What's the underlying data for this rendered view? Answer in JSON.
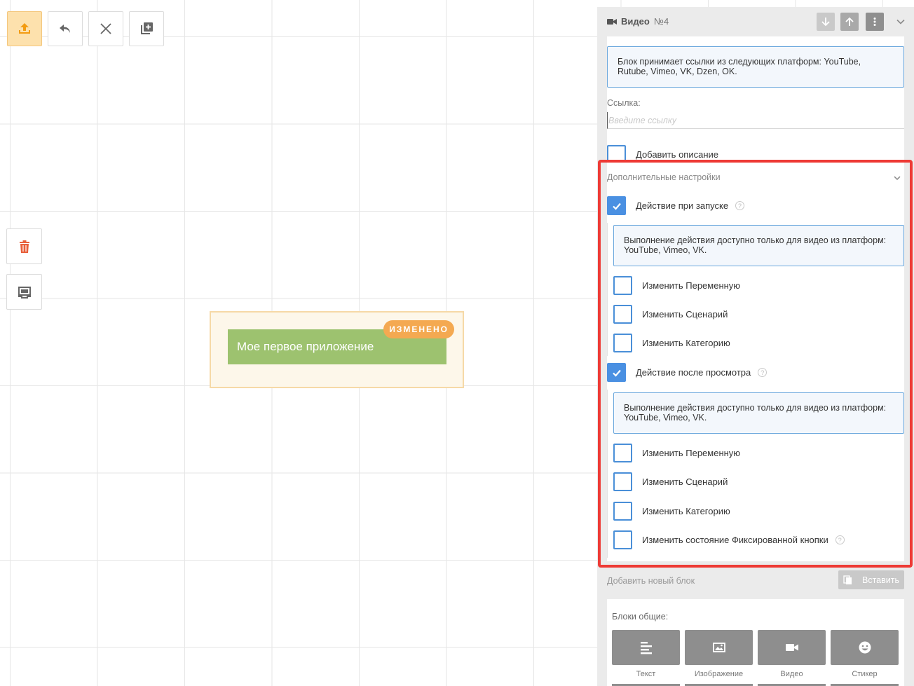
{
  "canvas": {
    "node_title": "Мое первое приложение",
    "node_badge": "ИЗМЕНЕНО"
  },
  "toolbar": {
    "icons": [
      "upload-icon",
      "undo-icon",
      "close-icon",
      "add-copy-icon"
    ]
  },
  "side_tools": {
    "icons": [
      "trash-icon",
      "screen-icon"
    ]
  },
  "panel": {
    "title": "Видео",
    "number": "№4",
    "info_text": "Блок принимает ссылки из следующих платформ: YouTube, Rutube, Vimeo, VK, Dzen, OK.",
    "link_label": "Ссылка:",
    "link_placeholder": "Введите ссылку",
    "link_value": "",
    "add_description_label": "Добавить описание",
    "add_description_checked": false
  },
  "advanced": {
    "title": "Дополнительные настройки",
    "on_start": {
      "label": "Действие при запуске",
      "checked": true,
      "info_text": "Выполнение действия доступно только для видео из платформ: YouTube, Vimeo, VK.",
      "options": [
        {
          "label": "Изменить Переменную",
          "checked": false
        },
        {
          "label": "Изменить Сценарий",
          "checked": false
        },
        {
          "label": "Изменить Категорию",
          "checked": false
        }
      ]
    },
    "after_view": {
      "label": "Действие после просмотра",
      "checked": true,
      "info_text": "Выполнение действия доступно только для видео из платформ: YouTube, Vimeo, VK.",
      "options": [
        {
          "label": "Изменить Переменную",
          "checked": false
        },
        {
          "label": "Изменить Сценарий",
          "checked": false
        },
        {
          "label": "Изменить Категорию",
          "checked": false
        },
        {
          "label": "Изменить состояние Фиксированной кнопки",
          "checked": false
        }
      ]
    }
  },
  "add_block": {
    "label": "Добавить новый блок",
    "paste_label": "Вставить"
  },
  "blocks": {
    "title": "Блоки общие:",
    "items": [
      {
        "label": "Текст",
        "icon": "text-icon"
      },
      {
        "label": "Изображение",
        "icon": "image-icon"
      },
      {
        "label": "Видео",
        "icon": "video-icon"
      },
      {
        "label": "Стикер",
        "icon": "sticker-icon"
      }
    ]
  },
  "colors": {
    "accent": "#4a90e2",
    "node_green": "#9dc26f",
    "badge_orange": "#f4a951",
    "highlight_red": "#ee3a35"
  }
}
